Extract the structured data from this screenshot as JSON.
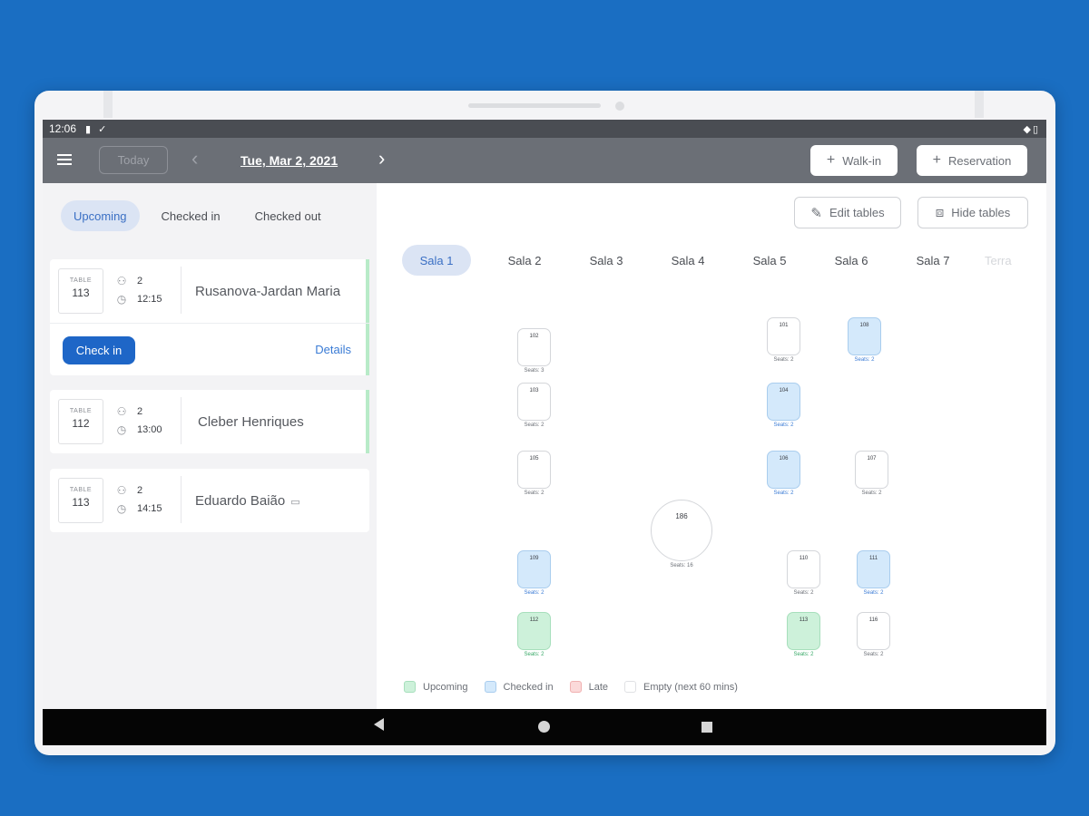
{
  "status_bar": {
    "time": "12:06"
  },
  "app_bar": {
    "today_label": "Today",
    "date_label": "Tue, Mar 2, 2021",
    "walkin_label": "Walk-in",
    "reservation_label": "Reservation"
  },
  "status_tabs": [
    "Upcoming",
    "Checked in",
    "Checked out"
  ],
  "reservations": [
    {
      "table_label": "TABLE",
      "table": "113",
      "guests": "2",
      "time": "12:15",
      "name": "Rusanova-Jardan Maria",
      "checkin_label": "Check in",
      "details_label": "Details"
    },
    {
      "table_label": "TABLE",
      "table": "112",
      "guests": "2",
      "time": "13:00",
      "name": "Cleber Henriques"
    },
    {
      "table_label": "TABLE",
      "table": "113",
      "guests": "2",
      "time": "14:15",
      "name": "Eduardo Baião"
    }
  ],
  "toolbar": {
    "edit_label": "Edit tables",
    "hide_label": "Hide tables"
  },
  "sala_tabs": [
    "Sala 1",
    "Sala 2",
    "Sala 3",
    "Sala 4",
    "Sala 5",
    "Sala 6",
    "Sala 7",
    "Terra"
  ],
  "tables": [
    {
      "num": "102",
      "seats": "Seats: 3",
      "status": "empty"
    },
    {
      "num": "103",
      "seats": "Seats: 2",
      "status": "empty"
    },
    {
      "num": "105",
      "seats": "Seats: 2",
      "status": "empty"
    },
    {
      "num": "109",
      "seats": "Seats: 2",
      "status": "checked"
    },
    {
      "num": "112",
      "seats": "Seats: 2",
      "status": "upcoming"
    },
    {
      "num": "101",
      "seats": "Seats: 2",
      "status": "empty"
    },
    {
      "num": "108",
      "seats": "Seats: 2",
      "status": "checked"
    },
    {
      "num": "104",
      "seats": "Seats: 2",
      "status": "checked"
    },
    {
      "num": "106",
      "seats": "Seats: 2",
      "status": "checked"
    },
    {
      "num": "107",
      "seats": "Seats: 2",
      "status": "empty"
    },
    {
      "num": "186",
      "seats": "Seats: 16",
      "status": "empty"
    },
    {
      "num": "110",
      "seats": "Seats: 2",
      "status": "empty"
    },
    {
      "num": "111",
      "seats": "Seats: 2",
      "status": "checked"
    },
    {
      "num": "113",
      "seats": "Seats: 2",
      "status": "upcoming"
    },
    {
      "num": "116",
      "seats": "Seats: 2",
      "status": "empty"
    }
  ],
  "legend": [
    "Upcoming",
    "Checked in",
    "Late",
    "Empty (next 60 mins)"
  ],
  "colors": {
    "accent": "#1e66c7",
    "appbar": "#6b6f76",
    "upcoming": "#cdf1da",
    "checked_in": "#d4e9fb",
    "late": "#fbd9d9",
    "background": "#1a6ec2"
  }
}
